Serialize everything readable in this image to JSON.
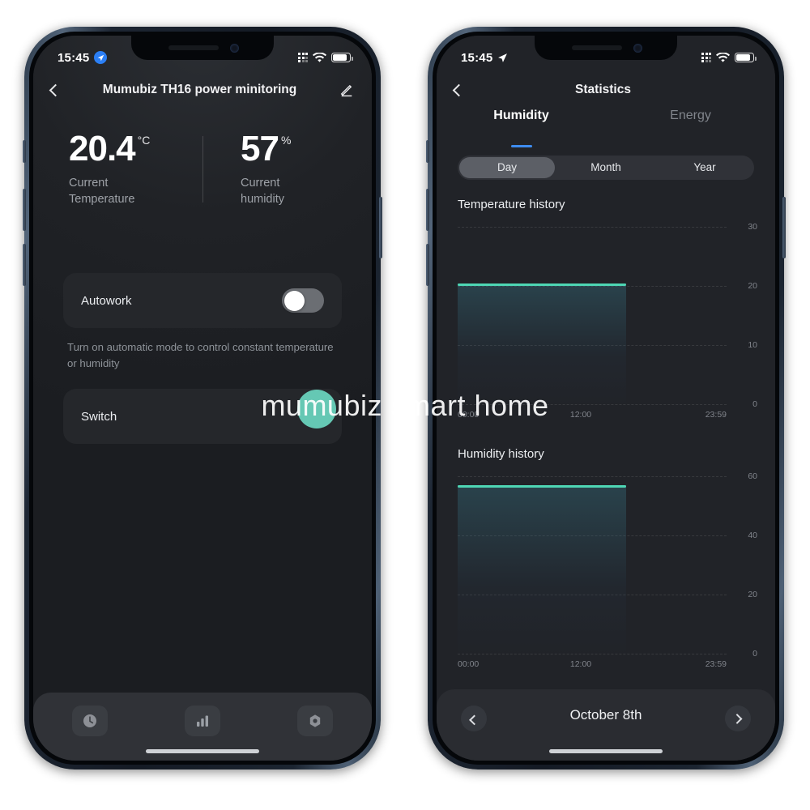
{
  "watermark": "mumubiz smart home",
  "colors": {
    "accent_blue": "#3e8cf0",
    "chart_line": "#4ed6b4",
    "touch_dot": "#6ad6c0",
    "card_bg": "#25272b",
    "screen_bg": "#212328"
  },
  "left_phone": {
    "status_bar": {
      "time": "15:45",
      "location_icon": "location-arrow-icon",
      "cellular_icon": "cellular-signal-icon",
      "wifi_icon": "wifi-icon",
      "battery_icon": "battery-icon"
    },
    "nav": {
      "back_icon": "chevron-left-icon",
      "title": "Mumubiz TH16 power minitoring",
      "edit_icon": "pencil-edit-icon"
    },
    "readouts": [
      {
        "value": "20.4",
        "unit": "°C",
        "label_line1": "Current",
        "label_line2": "Temperature"
      },
      {
        "value": "57",
        "unit": "%",
        "label_line1": "Current",
        "label_line2": "humidity"
      }
    ],
    "autowork": {
      "label": "Autowork",
      "toggle_state": "off"
    },
    "hint": "Turn on automatic mode to control constant temperature or humidity",
    "switch_card": {
      "label": "Switch"
    },
    "tabs": [
      {
        "name": "timer",
        "icon": "clock-icon"
      },
      {
        "name": "statistics",
        "icon": "bar-chart-icon"
      },
      {
        "name": "settings",
        "icon": "gear-icon"
      }
    ]
  },
  "right_phone": {
    "status_bar": {
      "time": "15:45",
      "location_icon": "location-arrow-icon",
      "cellular_icon": "cellular-signal-icon",
      "wifi_icon": "wifi-icon",
      "battery_icon": "battery-icon"
    },
    "nav": {
      "back_icon": "chevron-left-icon",
      "title": "Statistics"
    },
    "subtabs": [
      {
        "label": "Humidity",
        "active": true
      },
      {
        "label": "Energy",
        "active": false
      }
    ],
    "segments": [
      {
        "label": "Day",
        "selected": true
      },
      {
        "label": "Month",
        "selected": false
      },
      {
        "label": "Year",
        "selected": false
      }
    ],
    "date_nav": {
      "prev_icon": "chevron-left-icon",
      "date": "October 8th",
      "next_icon": "chevron-right-icon"
    }
  },
  "chart_data": [
    {
      "type": "area",
      "title": "Temperature history",
      "xlabel": "",
      "ylabel": "",
      "ylim": [
        0,
        30
      ],
      "yticks": [
        0,
        10,
        20,
        30
      ],
      "ytick_labels": [
        "0",
        "10",
        "20",
        "30"
      ],
      "xticks": [
        "00:00",
        "12:00",
        "23:59"
      ],
      "x": [
        "00:00",
        "15:45"
      ],
      "values": [
        20.4,
        20.4
      ],
      "series": [
        {
          "name": "Temperature",
          "values": [
            20.4,
            20.4
          ]
        }
      ],
      "grid": true,
      "legend": "none",
      "data_extends_to": "15:45"
    },
    {
      "type": "area",
      "title": "Humidity history",
      "xlabel": "",
      "ylabel": "",
      "ylim": [
        0,
        60
      ],
      "yticks": [
        0,
        20,
        40,
        60
      ],
      "ytick_labels": [
        "0",
        "20",
        "40",
        "60"
      ],
      "xticks": [
        "00:00",
        "12:00",
        "23:59"
      ],
      "x": [
        "00:00",
        "15:45"
      ],
      "values": [
        57,
        57
      ],
      "series": [
        {
          "name": "Humidity",
          "values": [
            57,
            57
          ]
        }
      ],
      "grid": true,
      "legend": "none",
      "data_extends_to": "15:45"
    }
  ]
}
